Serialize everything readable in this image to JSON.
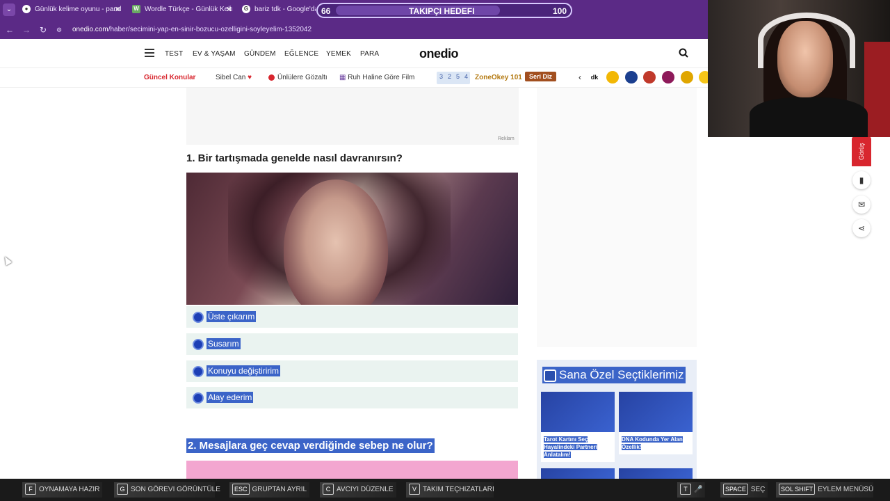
{
  "browser": {
    "tabs": [
      {
        "title": "Günlük kelime oyunu - parolla",
        "icon": "globe-icon"
      },
      {
        "title": "Wordle Türkçe - Günlük Kelime",
        "icon": "w-icon"
      },
      {
        "title": "bariz tdk - Google'da Ara",
        "icon": "google-icon"
      }
    ],
    "url_domain": "onedio.com",
    "url_path": "/haber/secimini-yap-en-sinir-bozucu-ozelligini-soyleyelim-1352042"
  },
  "goal_overlay": {
    "current": "66",
    "label": "TAKIPÇI HEDEFI",
    "target": "100",
    "progress": 0.66
  },
  "site": {
    "logo": "onedio",
    "nav": [
      "TEST",
      "EV & YAŞAM",
      "GÜNDEM",
      "EĞLENCE",
      "YEMEK",
      "PARA"
    ],
    "subnav": {
      "current": "Güncel Konular",
      "items": [
        "Sibel Can",
        "Ünlülere Gözaltı",
        "Ruh Haline Göre Film"
      ],
      "nums": [
        "3",
        "2",
        "5",
        "4"
      ],
      "zone": "ZoneOkey 101",
      "seri": "Seri Diz",
      "brand_icons": [
        "dk",
        "",
        "",
        "",
        "",
        "",
        ""
      ]
    },
    "ad_label": "Reklam",
    "question1": "1. Bir tartışmada genelde nasıl davranırsın?",
    "options": [
      "Üste çıkarım",
      "Susarım",
      "Konuyu değiştiririm",
      "Alay ederim"
    ],
    "question2": "2. Mesajlara geç cevap verdiğinde sebep ne olur?",
    "picks": {
      "title": "Sana Özel Seçtiklerimiz",
      "cards": [
        "Tarot Kartını Seç Hayalindeki Partneri Anlatalım!",
        "DNA Kodunda Yer Alan Özellik!"
      ]
    },
    "side_tab": "Görüş"
  },
  "colors": {
    "brand_purple": "#5b2a86",
    "accent_red": "#d8262e",
    "selection_blue": "#3b64c8"
  },
  "hud": [
    {
      "key": "F",
      "label": "OYNAMAYA HAZIR"
    },
    {
      "key": "G",
      "label": "SON GÖREVI GÖRÜNTÜLE"
    },
    {
      "key": "ESC",
      "label": "GRUPTAN AYRIL"
    },
    {
      "key": "C",
      "label": "AVCIYI DÜZENLE"
    },
    {
      "key": "V",
      "label": "TAKIM TEÇHIZATLARI"
    },
    {
      "key": "T",
      "label": ""
    },
    {
      "key": "SPACE",
      "label": "SEÇ"
    },
    {
      "key": "SOL SHIFT",
      "label": "EYLEM MENÜSÜ"
    }
  ]
}
